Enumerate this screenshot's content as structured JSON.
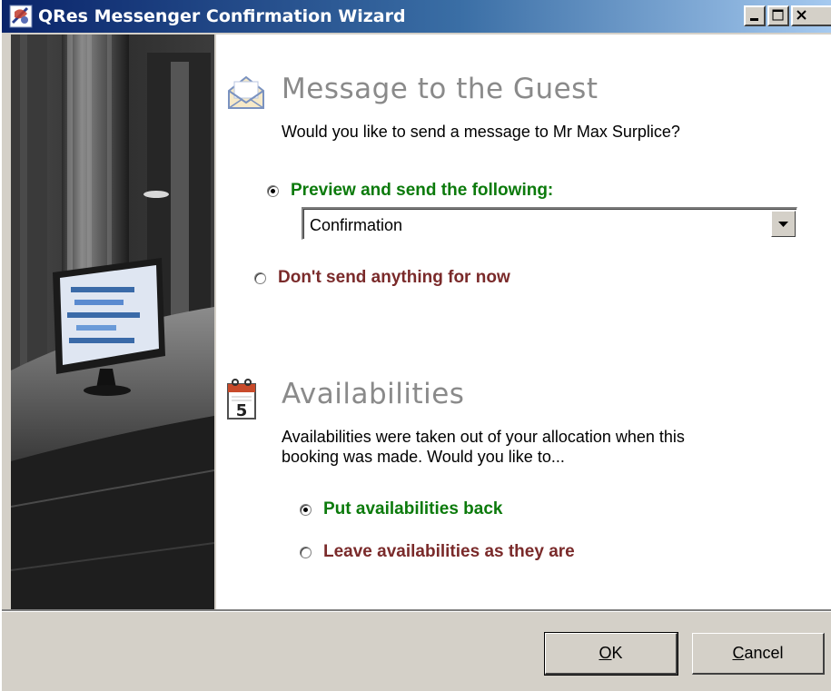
{
  "window": {
    "title": "QRes Messenger Confirmation Wizard",
    "app_icon": "qres-app-icon",
    "controls": [
      "minimize-icon",
      "maximize-icon",
      "close-icon"
    ]
  },
  "message_section": {
    "icon": "envelope-icon",
    "heading": "Message to the Guest",
    "description": "Would you like to send a message to Mr Max Surplice?",
    "options": [
      {
        "label": "Preview and send the following:",
        "selected": true,
        "color": "#0b7a0b"
      },
      {
        "label": "Don't send anything for now",
        "selected": false,
        "color": "#7a2a2a"
      }
    ],
    "template_select": {
      "value": "Confirmation"
    }
  },
  "availability_section": {
    "icon": "calendar-icon",
    "calendar_day": "5",
    "heading": "Availabilities",
    "description_line1": "Availabilities were taken out of your allocation when this",
    "description_line2": "booking was made. Would you like to...",
    "options": [
      {
        "label": "Put availabilities back",
        "selected": true,
        "color": "#0b7a0b"
      },
      {
        "label": "Leave availabilities as they are",
        "selected": false,
        "color": "#7a2a2a"
      }
    ]
  },
  "buttons": {
    "ok_mnemonic": "O",
    "ok_rest": "K",
    "cancel_mnemonic": "C",
    "cancel_rest": "ancel"
  }
}
